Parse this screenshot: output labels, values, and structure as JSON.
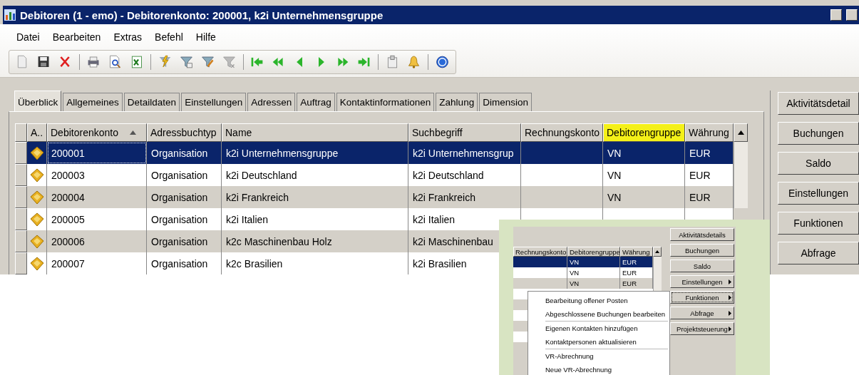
{
  "window": {
    "title": "Debitoren (1 - emo) - Debitorenkonto: 200001, k2i Unternehmensgruppe"
  },
  "menu": [
    "Datei",
    "Bearbeiten",
    "Extras",
    "Befehl",
    "Hilfe"
  ],
  "tabs": [
    {
      "label": "Überblick",
      "selected": true
    },
    {
      "label": "Allgemeines",
      "selected": false
    },
    {
      "label": "Detaildaten",
      "selected": false
    },
    {
      "label": "Einstellungen",
      "selected": false
    },
    {
      "label": "Adressen",
      "selected": false
    },
    {
      "label": "Auftrag",
      "selected": false
    },
    {
      "label": "Kontaktinformationen",
      "selected": false
    },
    {
      "label": "Zahlung",
      "selected": false
    },
    {
      "label": "Dimension",
      "selected": false
    }
  ],
  "table": {
    "icon_column_header": "A..",
    "columns": [
      {
        "label": "Debitorenkonto",
        "sorted": true,
        "highlighted": false
      },
      {
        "label": "Adressbuchtyp",
        "sorted": false,
        "highlighted": false
      },
      {
        "label": "Name",
        "sorted": false,
        "highlighted": false
      },
      {
        "label": "Suchbegriff",
        "sorted": false,
        "highlighted": false
      },
      {
        "label": "Rechnungskonto",
        "sorted": false,
        "highlighted": false
      },
      {
        "label": "Debitorengruppe",
        "sorted": false,
        "highlighted": true
      },
      {
        "label": "Währung",
        "sorted": false,
        "highlighted": false
      }
    ],
    "rows": [
      {
        "selected": true,
        "cells": [
          "200001",
          "Organisation",
          "k2i Unternehmensgruppe",
          "k2i Unternehmensgrup",
          null,
          "VN",
          "EUR"
        ]
      },
      {
        "selected": false,
        "cells": [
          "200003",
          "Organisation",
          "k2i Deutschland",
          "k2i Deutschland",
          null,
          "VN",
          "EUR"
        ]
      },
      {
        "selected": false,
        "cells": [
          "200004",
          "Organisation",
          "k2i Frankreich",
          "k2i Frankreich",
          null,
          "VN",
          "EUR"
        ]
      },
      {
        "selected": false,
        "cells": [
          "200005",
          "Organisation",
          "k2i Italien",
          "k2i Italien",
          null,
          null,
          null
        ]
      },
      {
        "selected": false,
        "cells": [
          "200006",
          "Organisation",
          "k2c Maschinenbau Holz",
          "k2i Maschinenbau",
          null,
          null,
          null
        ]
      },
      {
        "selected": false,
        "cells": [
          "200007",
          "Organisation",
          "k2c Brasilien",
          "k2i Brasilien",
          null,
          null,
          null
        ]
      }
    ]
  },
  "buttons": [
    "Aktivitätsdetail",
    "Buchungen",
    "Saldo",
    "Einstellungen",
    "Funktionen",
    "Abfrage"
  ],
  "inset": {
    "columns": [
      "Rechnungskonto",
      "Debitorengruppe",
      "Währung"
    ],
    "rows": [
      {
        "selected": true,
        "cells": [
          null,
          "VN",
          "EUR"
        ]
      },
      {
        "selected": false,
        "cells": [
          null,
          "VN",
          "EUR"
        ]
      },
      {
        "selected": false,
        "cells": [
          null,
          "VN",
          "EUR"
        ]
      }
    ],
    "buttons": [
      {
        "label": "Aktivitätsdetails",
        "submenu": false,
        "focused": false
      },
      {
        "label": "Buchungen",
        "submenu": false,
        "focused": false
      },
      {
        "label": "Saldo",
        "submenu": false,
        "focused": false
      },
      {
        "label": "Einstellungen",
        "submenu": true,
        "focused": false
      },
      {
        "label": "Funktionen",
        "submenu": true,
        "focused": true
      },
      {
        "label": "Abfrage",
        "submenu": true,
        "focused": false
      },
      {
        "label": "Projektsteuerung",
        "submenu": true,
        "focused": false
      }
    ],
    "context_menu": [
      [
        "Bearbeitung offener Posten",
        "Abgeschlossene Buchungen bearbeiten"
      ],
      [
        "Eigenen Kontakten hinzufügen",
        "Kontaktpersonen aktualisieren"
      ],
      [
        "VR-Abrechnung",
        "Neue VR-Abrechnung"
      ]
    ]
  }
}
